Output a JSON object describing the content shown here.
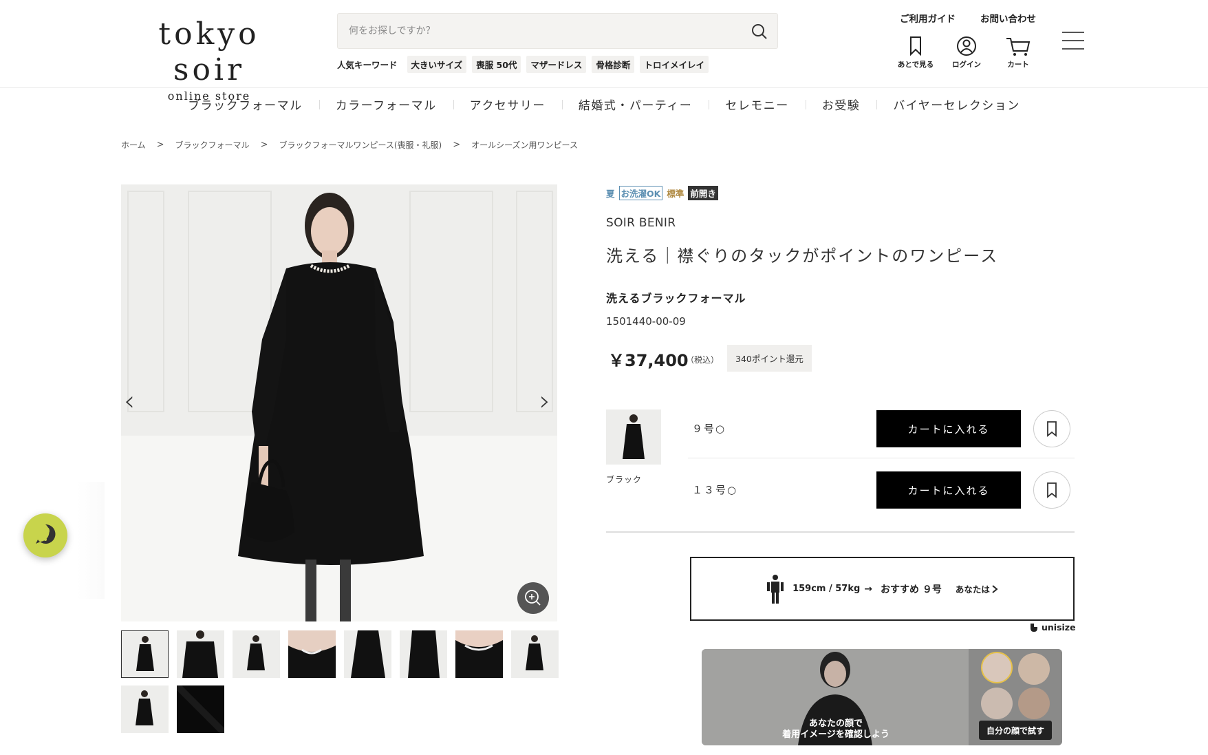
{
  "header": {
    "logo_main": "tokyo soir",
    "logo_sub": "online store",
    "search_placeholder": "何をお探しですか？",
    "keywords_title": "人気キーワード",
    "keywords": [
      "大きいサイズ",
      "喪服 50代",
      "マザードレス",
      "骨格診断",
      "トロイメイレイ"
    ],
    "top_links": [
      "ご利用ガイド",
      "お問い合わせ"
    ],
    "icons": [
      {
        "icon": "bookmark-icon",
        "label": "あとで見る"
      },
      {
        "icon": "user-icon",
        "label": "ログイン"
      },
      {
        "icon": "cart-icon",
        "label": "カート"
      }
    ]
  },
  "categories": [
    "ブラックフォーマル",
    "カラーフォーマル",
    "アクセサリー",
    "結婚式・パーティー",
    "セレモニー",
    "お受験",
    "バイヤーセレクション"
  ],
  "breadcrumb": {
    "items": [
      "ホーム",
      "ブラックフォーマル",
      "ブラックフォーマルワンピース(喪服・礼服)"
    ],
    "separator": ">",
    "current": "オールシーズン用ワンピース"
  },
  "gallery": {
    "prev": "‹",
    "next": "›",
    "thumb_count": 10
  },
  "product": {
    "tags": {
      "summer": "夏",
      "wash": "お洗濯OK",
      "standard": "標準",
      "front": "前開き"
    },
    "brand": "SOIR BENIR",
    "name": "洗える｜襟ぐりのタックがポイントのワンピース",
    "subtitle": "洗えるブラックフォーマル",
    "sku": "1501440-00-09",
    "price": "￥37,400",
    "tax": "（税込）",
    "points": "340ポイント還元",
    "variant_color": "ブラック",
    "sizes": [
      {
        "label": "９号○",
        "cart": "カートに入れる"
      },
      {
        "label": "１３号○",
        "cart": "カートに入れる"
      }
    ]
  },
  "unisize": {
    "body": "159cm / 57kg",
    "arrow": "→",
    "recommend": "おすすめ ９号",
    "you": "あなたは",
    "brand": "unisize"
  },
  "tryon": {
    "text_line1": "あなたの顔で",
    "text_line2": "着用イメージを確認しよう",
    "button": "自分の顔で試す"
  },
  "colors": {
    "help_bg": "#c8d44c",
    "tag_blue": "#5c8fb2",
    "tag_gold": "#b08a42"
  }
}
